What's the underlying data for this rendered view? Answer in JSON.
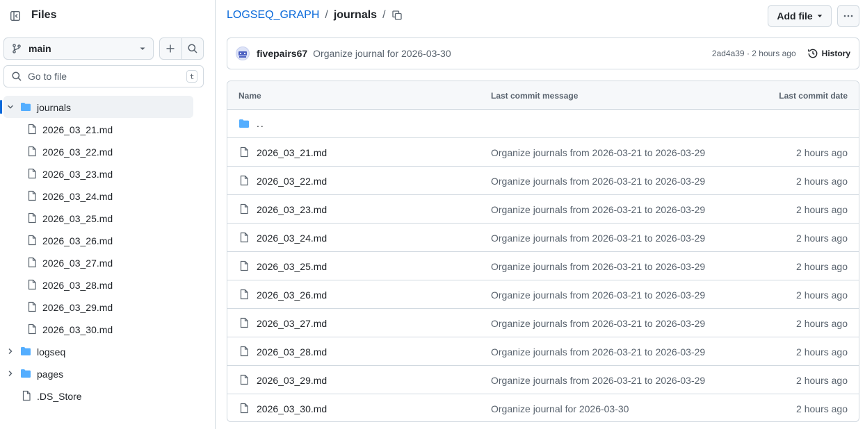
{
  "sidebar": {
    "title": "Files",
    "branch": "main",
    "search_placeholder": "Go to file",
    "search_shortcut": "t",
    "tree": {
      "journals_folder": "journals",
      "journal_files": [
        "2026_03_21.md",
        "2026_03_22.md",
        "2026_03_23.md",
        "2026_03_24.md",
        "2026_03_25.md",
        "2026_03_26.md",
        "2026_03_27.md",
        "2026_03_28.md",
        "2026_03_29.md",
        "2026_03_30.md"
      ],
      "other_folders": [
        "logseq",
        "pages"
      ],
      "root_files": [
        ".DS_Store"
      ]
    }
  },
  "breadcrumb": {
    "repo": "LOGSEQ_GRAPH",
    "separator": "/",
    "current": "journals"
  },
  "toolbar": {
    "add_file": "Add file"
  },
  "latest_commit": {
    "author": "fivepairs67",
    "message": "Organize journal for 2026-03-30",
    "meta": "2ad4a39 · 2 hours ago",
    "history_label": "History"
  },
  "table": {
    "headers": {
      "name": "Name",
      "message": "Last commit message",
      "date": "Last commit date"
    },
    "parent_label": "..",
    "rows": [
      {
        "name": "2026_03_21.md",
        "message": "Organize journals from 2026-03-21 to 2026-03-29",
        "date": "2 hours ago"
      },
      {
        "name": "2026_03_22.md",
        "message": "Organize journals from 2026-03-21 to 2026-03-29",
        "date": "2 hours ago"
      },
      {
        "name": "2026_03_23.md",
        "message": "Organize journals from 2026-03-21 to 2026-03-29",
        "date": "2 hours ago"
      },
      {
        "name": "2026_03_24.md",
        "message": "Organize journals from 2026-03-21 to 2026-03-29",
        "date": "2 hours ago"
      },
      {
        "name": "2026_03_25.md",
        "message": "Organize journals from 2026-03-21 to 2026-03-29",
        "date": "2 hours ago"
      },
      {
        "name": "2026_03_26.md",
        "message": "Organize journals from 2026-03-21 to 2026-03-29",
        "date": "2 hours ago"
      },
      {
        "name": "2026_03_27.md",
        "message": "Organize journals from 2026-03-21 to 2026-03-29",
        "date": "2 hours ago"
      },
      {
        "name": "2026_03_28.md",
        "message": "Organize journals from 2026-03-21 to 2026-03-29",
        "date": "2 hours ago"
      },
      {
        "name": "2026_03_29.md",
        "message": "Organize journals from 2026-03-21 to 2026-03-29",
        "date": "2 hours ago"
      },
      {
        "name": "2026_03_30.md",
        "message": "Organize journal for 2026-03-30",
        "date": "2 hours ago"
      }
    ]
  },
  "colors": {
    "accent_link": "#0969da",
    "folder_icon": "#54aeff",
    "muted_text": "#59636e",
    "border": "#d1d9e0",
    "header_bg": "#f6f8fa"
  },
  "icons": {
    "panel": "sidebar-collapse-icon",
    "branch": "git-branch-icon",
    "caret": "triangle-down-icon",
    "plus": "plus-icon",
    "search": "search-icon",
    "folder": "folder-icon",
    "file": "file-icon",
    "chevron_down": "chevron-down-icon",
    "chevron_right": "chevron-right-icon",
    "copy": "copy-icon",
    "kebab": "kebab-horizontal-icon",
    "history": "history-icon"
  }
}
